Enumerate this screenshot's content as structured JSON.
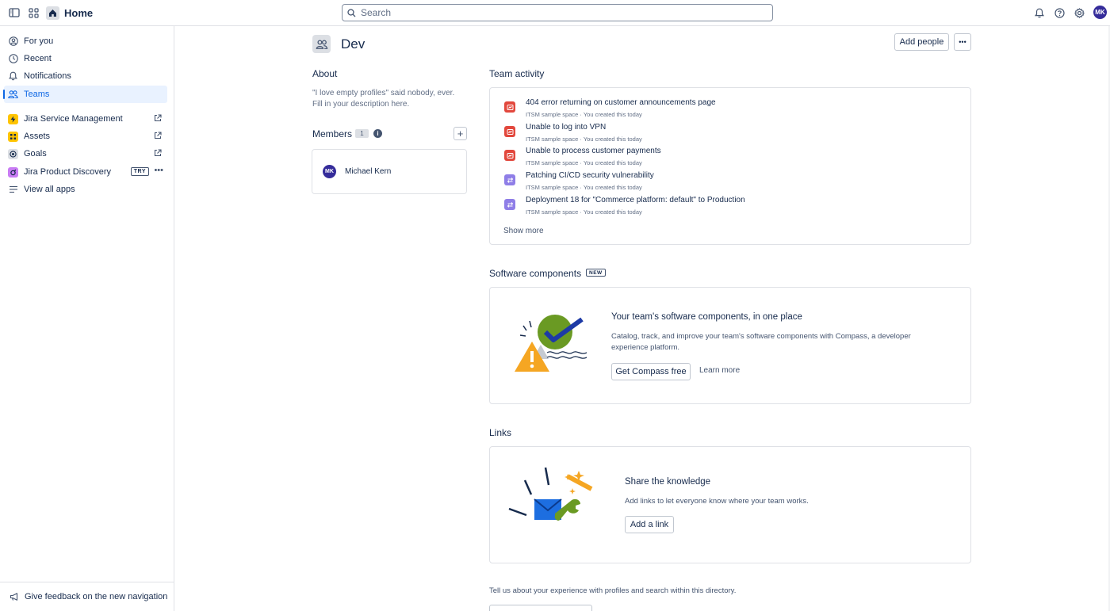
{
  "topbar": {
    "home_label": "Home",
    "search_placeholder": "Search",
    "avatar_initials": "MK"
  },
  "sidebar": {
    "items": [
      {
        "label": "For you"
      },
      {
        "label": "Recent"
      },
      {
        "label": "Notifications"
      },
      {
        "label": "Teams"
      }
    ],
    "apps": [
      {
        "label": "Jira Service Management"
      },
      {
        "label": "Assets"
      },
      {
        "label": "Goals"
      },
      {
        "label": "Jira Product Discovery",
        "badge": "TRY"
      }
    ],
    "view_all": "View all apps",
    "feedback": "Give feedback on the new navigation"
  },
  "team": {
    "name": "Dev",
    "add_people": "Add people"
  },
  "about": {
    "heading": "About",
    "text": "\"I love empty profiles\" said nobody, ever. Fill in your description here."
  },
  "members": {
    "heading": "Members",
    "count": "1",
    "list": [
      {
        "initials": "MK",
        "name": "Michael Kern"
      }
    ]
  },
  "activity": {
    "heading": "Team activity",
    "items": [
      {
        "title": "404 error returning on customer announcements page",
        "space": "ITSM sample space",
        "meta": "You created this today",
        "type": "incident"
      },
      {
        "title": "Unable to log into VPN",
        "space": "ITSM sample space",
        "meta": "You created this today",
        "type": "incident"
      },
      {
        "title": "Unable to process customer payments",
        "space": "ITSM sample space",
        "meta": "You created this today",
        "type": "incident"
      },
      {
        "title": "Patching CI/CD security vulnerability",
        "space": "ITSM sample space",
        "meta": "You created this today",
        "type": "change"
      },
      {
        "title": "Deployment 18 for \"Commerce platform: default\" to Production",
        "space": "ITSM sample space",
        "meta": "You created this today",
        "type": "change"
      }
    ],
    "show_more": "Show more",
    "separator": "·"
  },
  "components": {
    "heading": "Software components",
    "badge": "NEW",
    "title": "Your team's software components, in one place",
    "desc": "Catalog, track, and improve your team's software components with Compass, a developer experience platform.",
    "primary": "Get Compass free",
    "secondary": "Learn more"
  },
  "links": {
    "heading": "Links",
    "title": "Share the knowledge",
    "desc": "Add links to let everyone know where your team works.",
    "button": "Add a link"
  },
  "footer": {
    "text": "Tell us about your experience with profiles and search within this directory."
  },
  "colors": {
    "accent": "#0c66e4",
    "incident": "#e2483d",
    "change": "#8f7ee7",
    "avatar": "#352c9a"
  }
}
